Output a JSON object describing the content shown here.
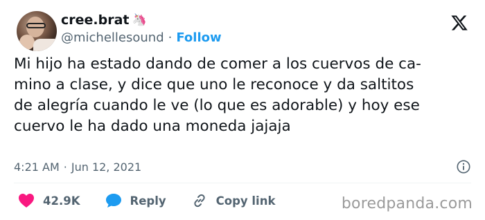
{
  "user": {
    "display_name": "cree.brat",
    "name_emoji": "🦄",
    "handle": "@michellesound",
    "separator": "·",
    "follow_label": "Follow"
  },
  "tweet": {
    "lines": [
      "Mi hijo ha estado dando de comer a los cuervos de ca-",
      "mino a clase, y dice que uno le reconoce y da saltitos",
      "de alegría cuando le ve (lo que es adorable) y hoy ese",
      "cuervo le ha dado una moneda jajaja"
    ],
    "time": "4:21 AM",
    "meta_separator": "·",
    "date": "Jun 12, 2021"
  },
  "actions": {
    "likes": "42.9K",
    "reply_label": "Reply",
    "copy_link_label": "Copy link"
  },
  "icons": {
    "platform": "x-logo-icon",
    "info": "info-icon",
    "like": "heart-icon",
    "reply": "speech-bubble-icon",
    "link": "link-icon"
  },
  "colors": {
    "accent": "#1d9bf0",
    "heart": "#f91880",
    "secondary_text": "#536471"
  },
  "watermark": "boredpanda.com"
}
